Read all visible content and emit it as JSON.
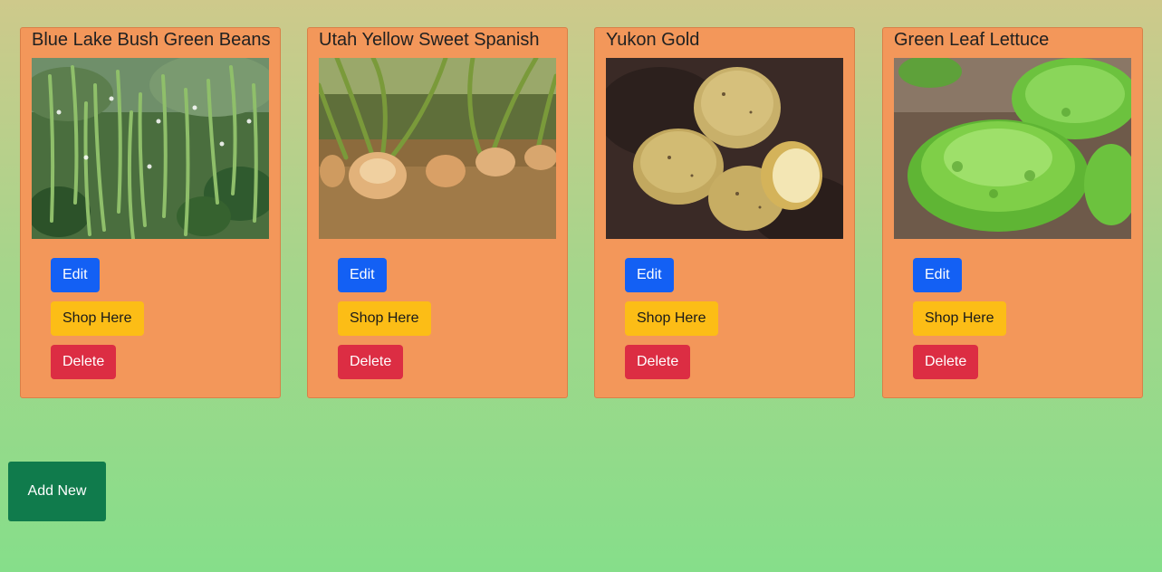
{
  "cards": [
    {
      "title": "Blue Lake Bush Green Beans",
      "image_icon": "green-beans-photo",
      "edit_label": "Edit",
      "shop_label": "Shop Here",
      "delete_label": "Delete"
    },
    {
      "title": "Utah Yellow Sweet Spanish",
      "image_icon": "onions-photo",
      "edit_label": "Edit",
      "shop_label": "Shop Here",
      "delete_label": "Delete"
    },
    {
      "title": "Yukon Gold",
      "image_icon": "potatoes-photo",
      "edit_label": "Edit",
      "shop_label": "Shop Here",
      "delete_label": "Delete"
    },
    {
      "title": "Green Leaf Lettuce",
      "image_icon": "lettuce-photo",
      "edit_label": "Edit",
      "shop_label": "Shop Here",
      "delete_label": "Delete"
    }
  ],
  "add_new_label": "Add New",
  "colors": {
    "card_bg": "#f3975a",
    "edit": "#1360f4",
    "shop": "#fcbd16",
    "delete": "#dc2d43",
    "add_new": "#107b4c"
  }
}
